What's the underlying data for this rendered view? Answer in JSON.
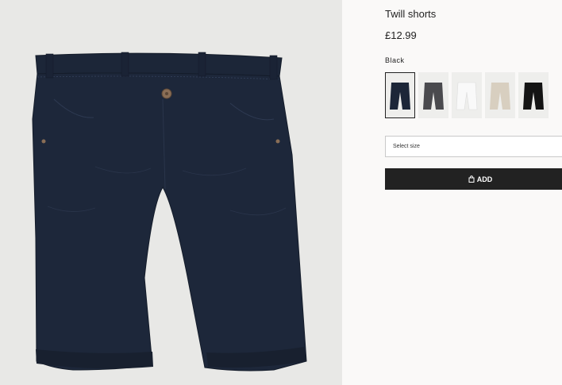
{
  "product": {
    "title": "Twill shorts",
    "price": "£12.99",
    "selected_color": "Black",
    "image": {
      "subject": "navy twill shorts",
      "icon": "product-photo"
    }
  },
  "swatches": [
    {
      "color": "#1c2638",
      "selected": true
    },
    {
      "color": "#4a4a4e",
      "selected": false
    },
    {
      "color": "#f4f4f4",
      "selected": false
    },
    {
      "color": "#d8cfc0",
      "selected": false
    },
    {
      "color": "#141414",
      "selected": false
    }
  ],
  "size_select": {
    "placeholder": "Select size"
  },
  "add_button": {
    "label": "ADD",
    "icon": "bag-icon"
  },
  "colors": {
    "page_bg": "#faf9f8",
    "image_bg": "#e8e8e6",
    "button_bg": "#222222",
    "shorts": "#1c2638"
  }
}
